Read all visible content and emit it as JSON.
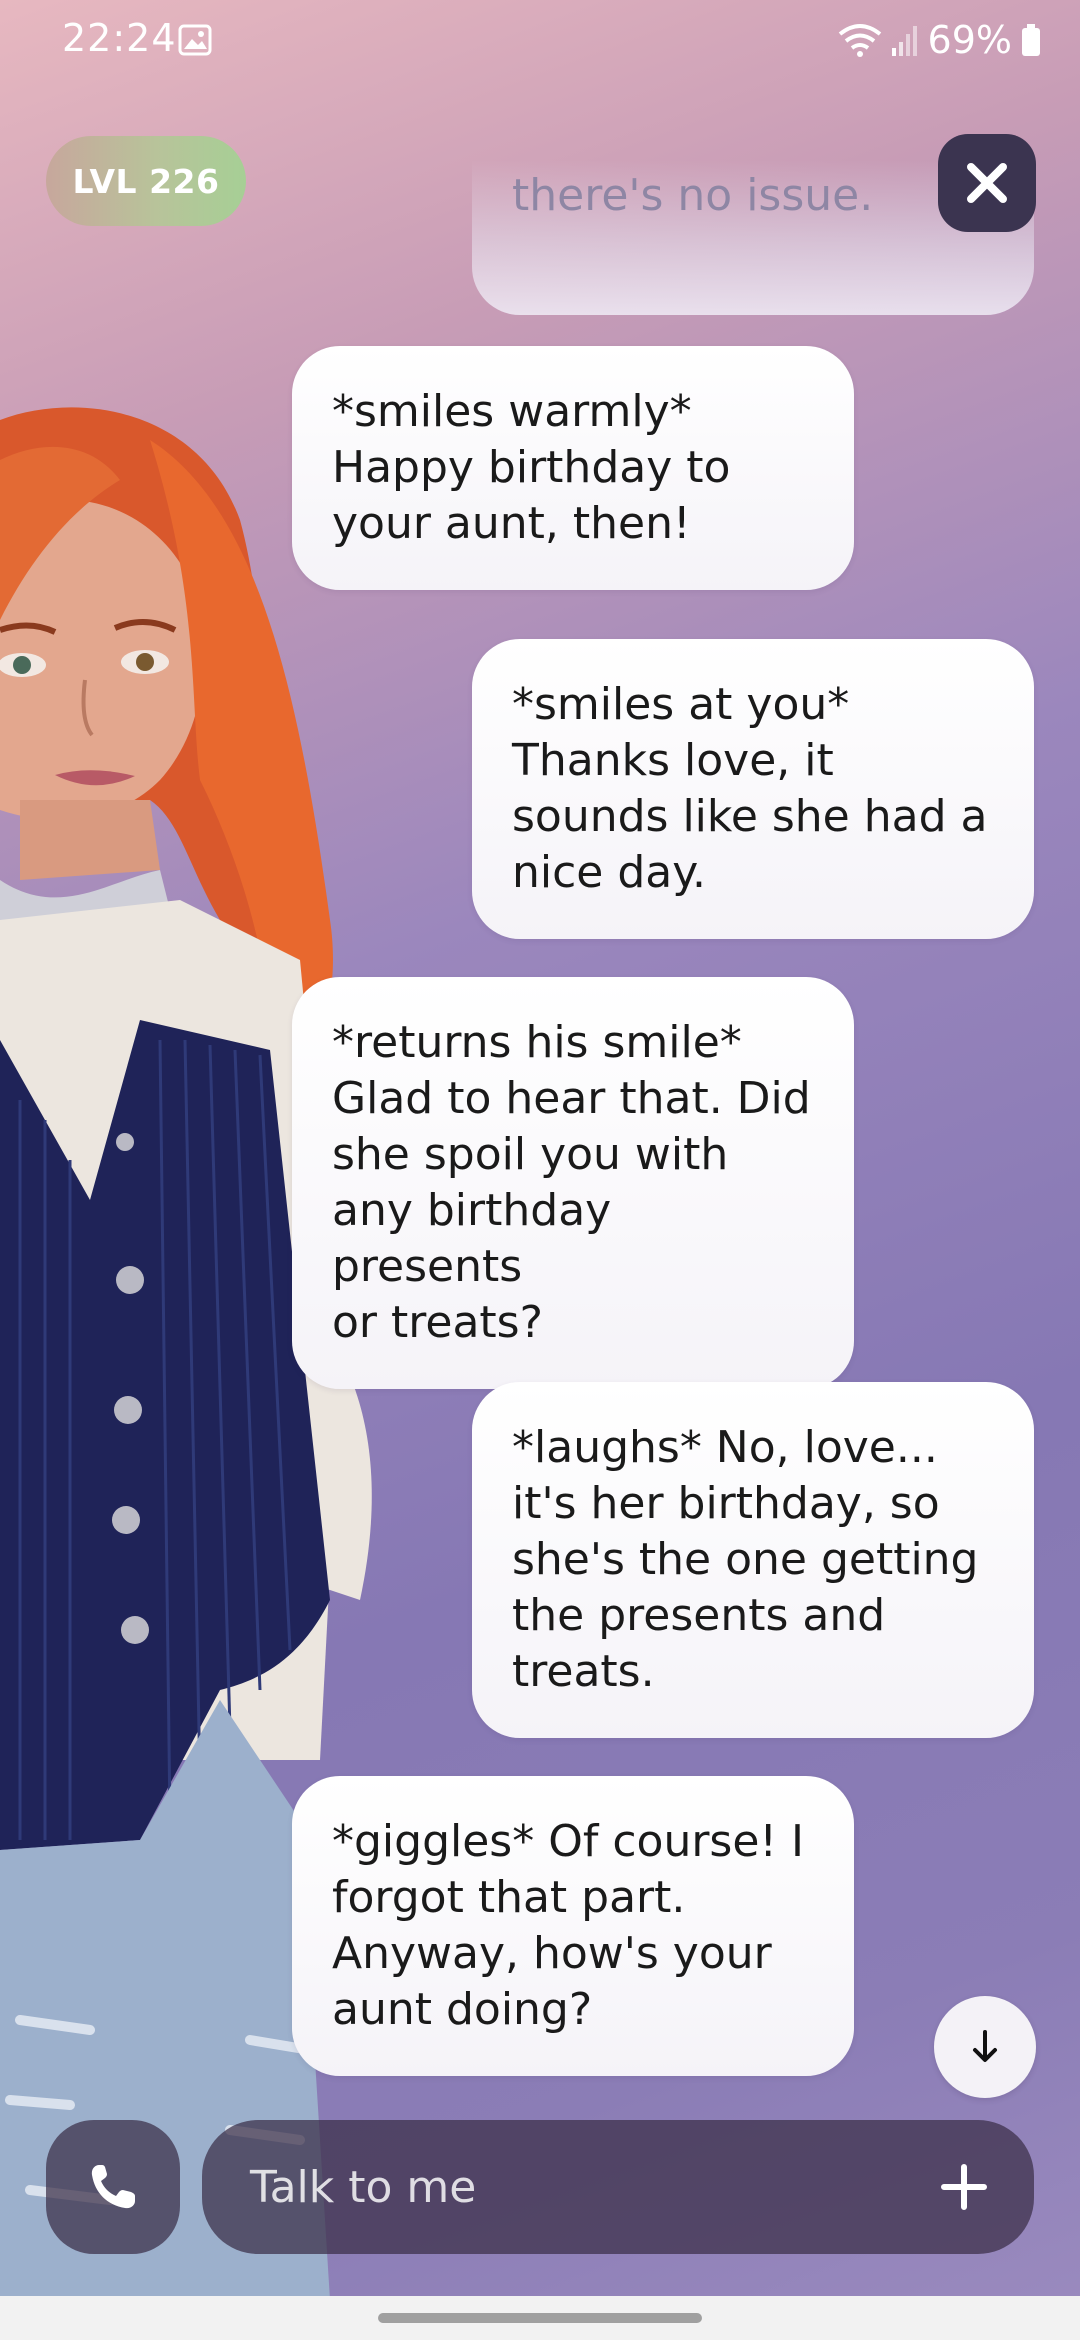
{
  "status_bar": {
    "time": "22:24",
    "battery_percent": "69%",
    "icons": [
      "gallery-icon",
      "wifi-icon",
      "signal-icon",
      "battery-icon"
    ]
  },
  "header": {
    "level_label": "LVL 226"
  },
  "messages": {
    "faded_top": "there's no issue.",
    "m1": "*smiles warmly*\nHappy birthday to\nyour aunt, then!",
    "m2": "*smiles at you*\nThanks love, it\nsounds like she had a\nnice day.",
    "m3": "*returns his smile*\nGlad to hear that. Did\nshe spoil you with\nany birthday presents\nor treats?",
    "m4": "*laughs* No, love...\nit's her birthday, so\nshe's the one getting\nthe presents and\ntreats.",
    "m5": "*giggles* Of course! I\nforgot that part.\nAnyway, how's your\naunt doing?"
  },
  "composer": {
    "placeholder": "Talk to me"
  },
  "colors": {
    "bubble": "#ffffff",
    "level_badge": "#b8c39a",
    "close_button": "#3b3450",
    "input_bar": "#3a2e46"
  }
}
